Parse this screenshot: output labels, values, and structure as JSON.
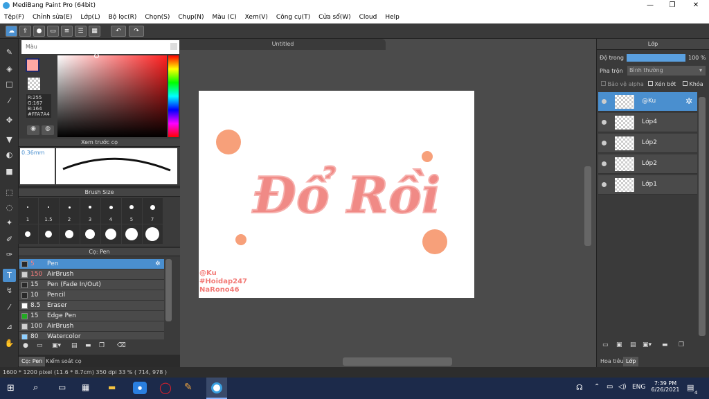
{
  "window": {
    "title": "MediBang Paint Pro (64bit)",
    "minimize": "—",
    "maximize": "❐",
    "close": "✕"
  },
  "menu": [
    "Tệp(F)",
    "Chỉnh sửa(E)",
    "Lớp(L)",
    "Bộ lọc(R)",
    "Chọn(S)",
    "Chụp(N)",
    "Màu (C)",
    "Xem(V)",
    "Công cụ(T)",
    "Cửa sổ(W)",
    "Cloud",
    "Help"
  ],
  "color_panel": {
    "title": "Màu",
    "r": "R:255",
    "g": "G:167",
    "b": "B:164",
    "hex": "#FFA7A4",
    "primary": "#ffa7a4"
  },
  "preview_panel": {
    "title": "Xem trước cọ",
    "size": "0.36mm"
  },
  "brush_size_panel": {
    "title": "Brush Size",
    "sizes": [
      "1",
      "1.5",
      "2",
      "3",
      "4",
      "5",
      "7"
    ]
  },
  "brush_panel": {
    "title": "Cọ: Pen",
    "items": [
      {
        "size": "5",
        "name": "Pen",
        "color": "#2a2a2a"
      },
      {
        "size": "150",
        "name": "AirBrush",
        "color": "#cfcfcf"
      },
      {
        "size": "15",
        "name": "Pen (Fade In/Out)",
        "color": "#2a2a2a"
      },
      {
        "size": "10",
        "name": "Pencil",
        "color": "#2a2a2a"
      },
      {
        "size": "8.5",
        "name": "Eraser",
        "color": "#ffffff"
      },
      {
        "size": "15",
        "name": "Edge Pen",
        "color": "#22aa22"
      },
      {
        "size": "100",
        "name": "AirBrush",
        "color": "#cfcfcf"
      },
      {
        "size": "80",
        "name": "Watercolor",
        "color": "#8ecfff"
      }
    ]
  },
  "bottom_tabs": {
    "brush": "Cọ: Pen",
    "control": "Kiểm soát cọ"
  },
  "canvas": {
    "tab": "Untitled",
    "art_text": "Đổ Rồi",
    "credit1": "@Ku",
    "credit2": "#Hoidap247",
    "credit3": "NaRono46"
  },
  "layer_panel": {
    "title": "Lớp",
    "opacity_label": "Độ trong",
    "opacity_value": "100 %",
    "blend_label": "Pha trộn",
    "blend_value": "Bình thường",
    "protect_alpha": "Bảo vệ alpha",
    "clip": "Xén bớt",
    "lock": "Khóa",
    "layers": [
      "@Ku",
      "Lớp4",
      "Lớp2",
      "Lớp2",
      "Lớp1"
    ],
    "tab_nav": "Hoa tiêu",
    "tab_layer": "Lớp"
  },
  "status": {
    "text": "1600 * 1200 pixel   (11.6 * 8.7cm)   350 dpi   33 %   ( 714, 978 )"
  },
  "taskbar": {
    "lang": "ENG",
    "time": "7:39 PM",
    "date": "6/26/2021",
    "notif": "4"
  }
}
